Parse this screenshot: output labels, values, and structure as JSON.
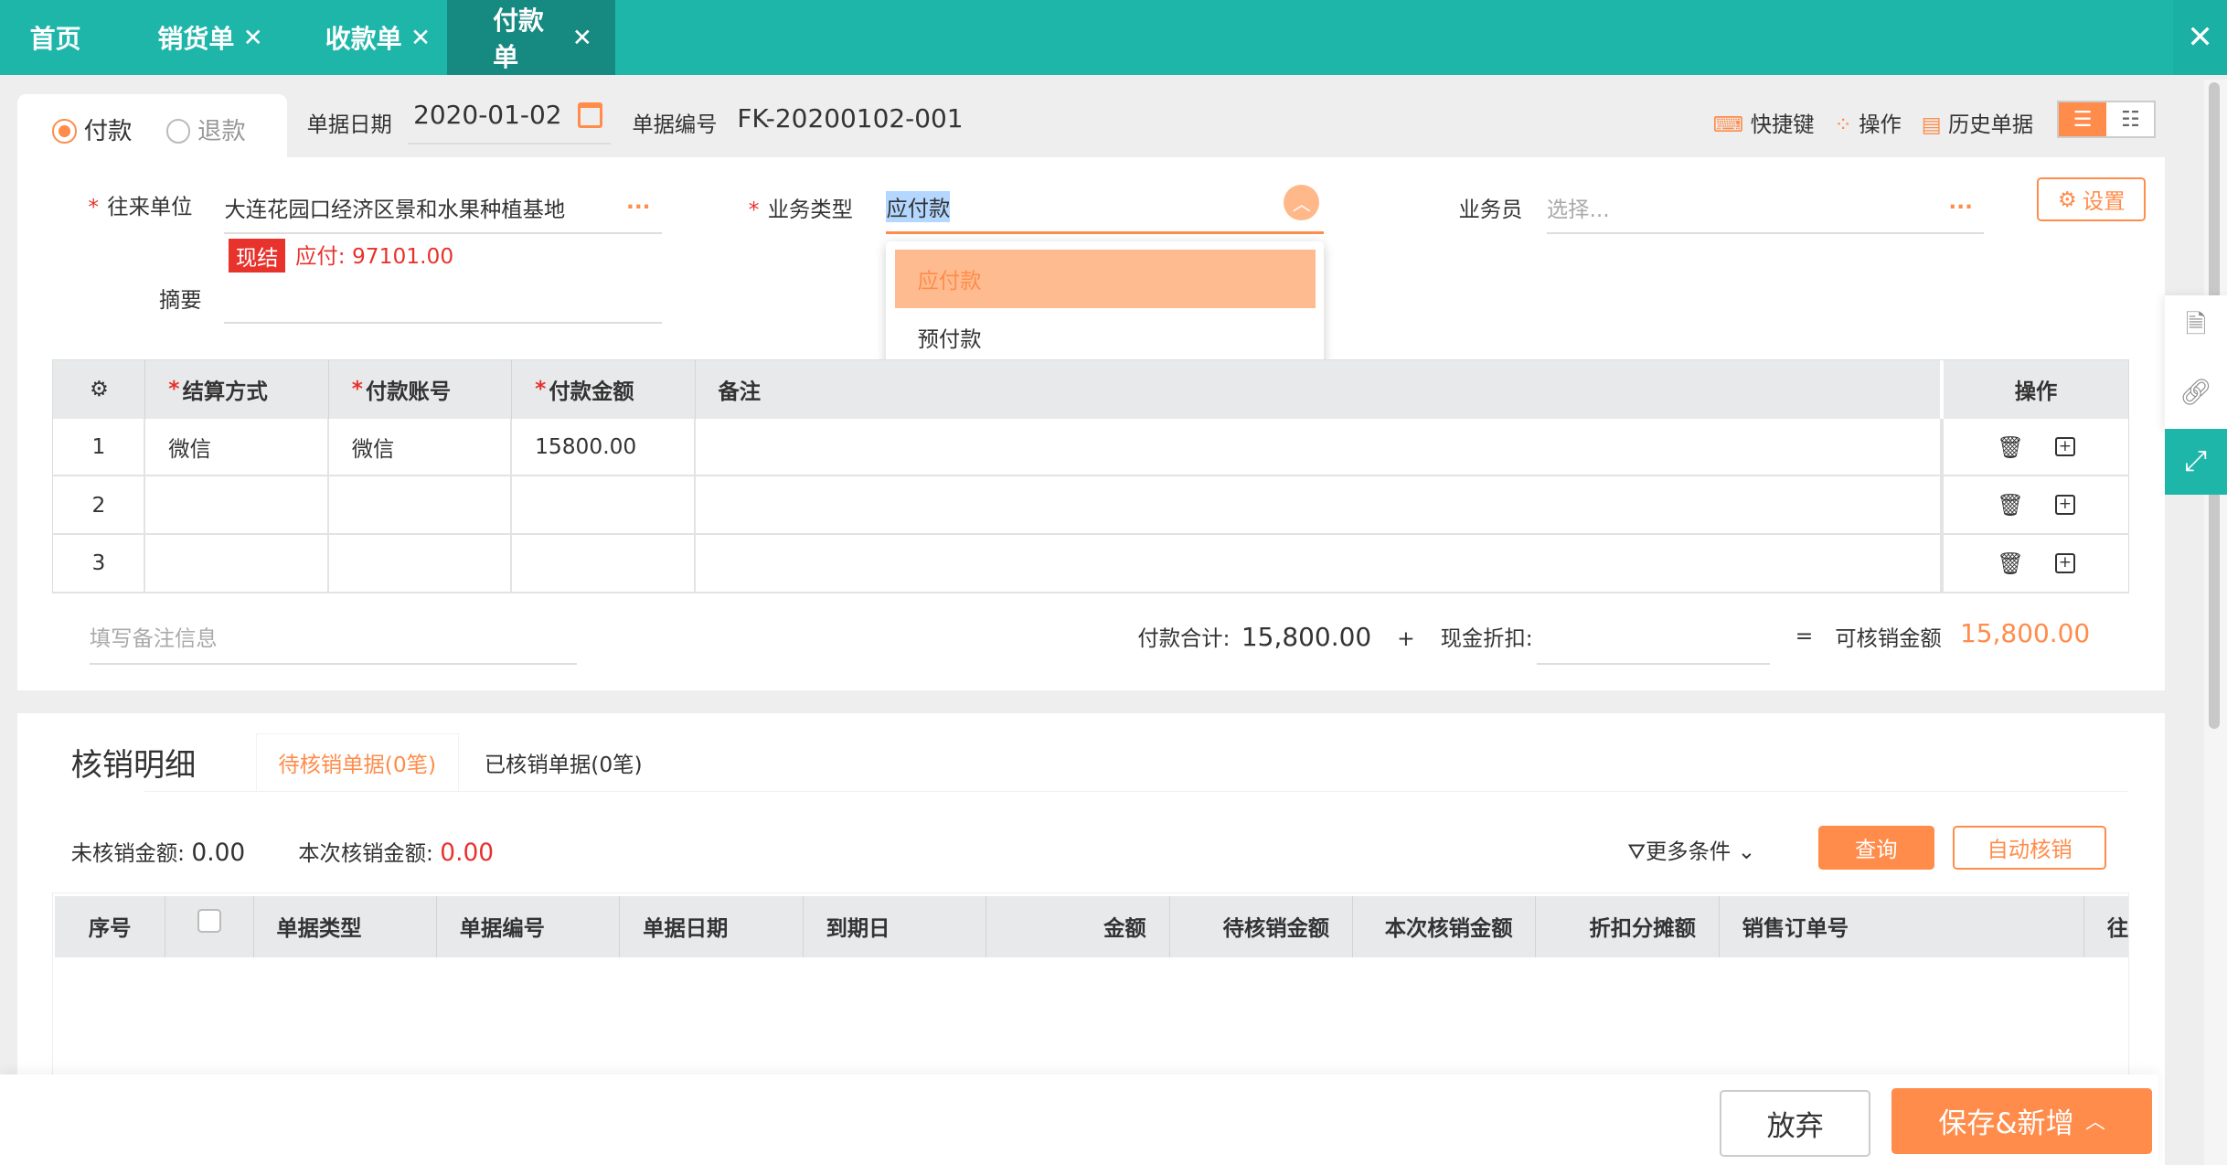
{
  "tabs": [
    {
      "label": "首页",
      "closable": false
    },
    {
      "label": "销货单",
      "closable": true
    },
    {
      "label": "收款单",
      "closable": true
    },
    {
      "label": "付款单",
      "closable": true,
      "active": true
    }
  ],
  "close_glyph": "✕",
  "close_all_glyph": "✕",
  "header": {
    "type_options": [
      {
        "label": "付款",
        "selected": true
      },
      {
        "label": "退款",
        "selected": false
      }
    ],
    "date_label": "单据日期",
    "date_value": "2020-01-02",
    "number_label": "单据编号",
    "number_value": "FK-20200102-001",
    "shortcut_label": "快捷键",
    "actions_label": "操作",
    "history_label": "历史单据"
  },
  "form": {
    "partner_label": "往来单位",
    "partner_value": "大连花园口经济区景和水果种植基地",
    "settle_badge": "现结",
    "payable_text": "应付: 97101.00",
    "summary_label": "摘要",
    "biz_type_label": "业务类型",
    "biz_type_value": "应付款",
    "biz_type_options": [
      "应付款",
      "预付款"
    ],
    "salesman_label": "业务员",
    "salesman_placeholder": "选择...",
    "settings_label": "设置",
    "more_glyph": "···"
  },
  "detail_table": {
    "headers": [
      "结算方式",
      "付款账号",
      "付款金额",
      "备注",
      "操作"
    ],
    "rows": [
      {
        "no": "1",
        "method": "微信",
        "account": "微信",
        "amount": "15800.00",
        "note": ""
      },
      {
        "no": "2",
        "method": "",
        "account": "",
        "amount": "",
        "note": ""
      },
      {
        "no": "3",
        "method": "",
        "account": "",
        "amount": "",
        "note": ""
      }
    ]
  },
  "totals": {
    "note_placeholder": "填写备注信息",
    "pay_total_label": "付款合计:",
    "pay_total_value": "15,800.00",
    "plus": "+",
    "discount_label": "现金折扣:",
    "equals": "=",
    "writeoff_label": "可核销金额",
    "writeoff_value": "15,800.00"
  },
  "writeoff": {
    "title": "核销明细",
    "tabs": [
      {
        "label": "待核销单据(0笔)",
        "active": true
      },
      {
        "label": "已核销单据(0笔)",
        "active": false
      }
    ],
    "unwritten_label": "未核销金额:",
    "unwritten_value": "0.00",
    "current_label": "本次核销金额:",
    "current_value": "0.00",
    "more_filters": "更多条件",
    "query": "查询",
    "auto": "自动核销",
    "headers": [
      "序号",
      "",
      "单据类型",
      "单据编号",
      "单据日期",
      "到期日",
      "金额",
      "待核销金额",
      "本次核销金额",
      "折扣分摊额",
      "销售订单号",
      "往"
    ]
  },
  "footer": {
    "discard": "放弃",
    "save_new": "保存&新增"
  },
  "colors": {
    "teal": "#1fb6aa",
    "orange": "#ff8c4b",
    "red": "#e8322c"
  }
}
